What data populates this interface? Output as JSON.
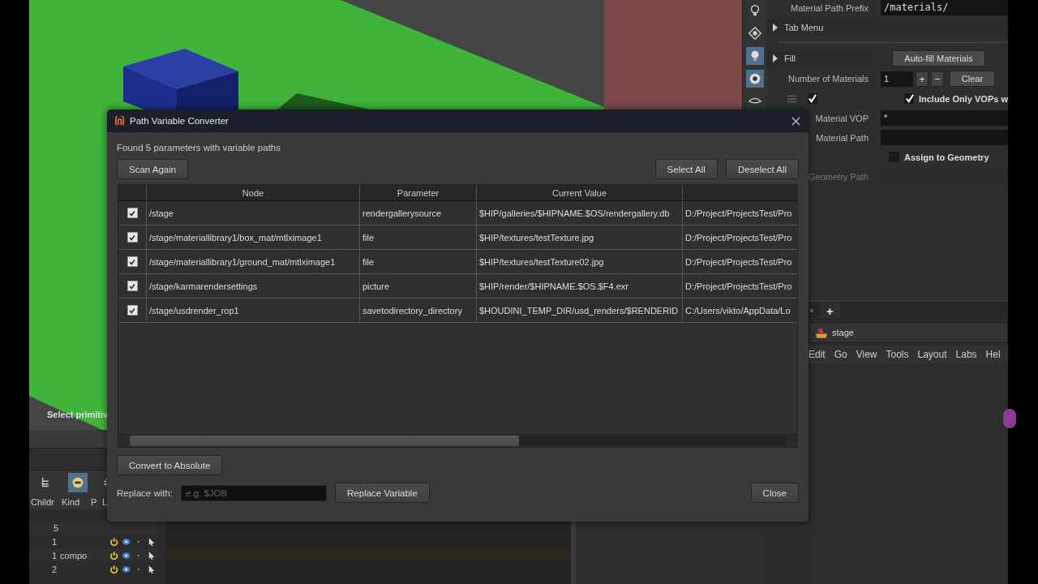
{
  "viewport": {
    "prompt": "Select primitiv"
  },
  "parameters": {
    "prefix": {
      "label": "Material Path Prefix",
      "value": "/materials/"
    },
    "sections": [
      {
        "label": "Tab Menu",
        "expanded": false
      },
      {
        "label": "Fill",
        "expanded": false
      }
    ],
    "autofill_button": "Auto-fill Materials",
    "count": {
      "label": "Number of Materials",
      "value": "1",
      "plus": "+",
      "minus": "−",
      "clear": "Clear"
    },
    "row_checked": true,
    "include_only": {
      "label": "Include Only VOPs w",
      "checked": true
    },
    "material_vop": {
      "label": "Material VOP",
      "value": "*"
    },
    "material_path": {
      "label": "Material Path"
    },
    "assign": {
      "label": "Assign to Geometry",
      "checked": false
    },
    "geometry_path": {
      "label": "Geometry Path",
      "disabled": true
    }
  },
  "network": {
    "new_tab": "+",
    "path": "stage",
    "menu": [
      "Edit",
      "Go",
      "View",
      "Tools",
      "Layout",
      "Labs",
      "Hel"
    ]
  },
  "scene_graph": {
    "columns": [
      "Childr",
      "Kind",
      "P",
      "L"
    ],
    "rows": [
      {
        "children": "5",
        "toggles": false
      },
      {
        "children": "1",
        "toggles": true
      },
      {
        "children": "1",
        "kind": "compo",
        "toggles": true
      },
      {
        "children": "2",
        "toggles": true
      }
    ]
  },
  "dialog": {
    "title": "Path Variable Converter",
    "message": "Found 5 parameters with variable paths",
    "scan_button": "Scan Again",
    "select_all": "Select All",
    "deselect_all": "Deselect All",
    "table": {
      "columns": [
        "Node",
        "Parameter",
        "Current Value"
      ],
      "rows": [
        {
          "checked": true,
          "node": "/stage",
          "parameter": "rendergallerysource",
          "current_value": "$HIP/galleries/$HIPNAME.$OS/rendergallery.db",
          "column_5": "D:/Project/ProjectsTest/Pro"
        },
        {
          "checked": true,
          "node": "/stage/materiallibrary1/box_mat/mtlximage1",
          "parameter": "file",
          "current_value": "$HIP/textures/testTexture.jpg",
          "column_5": "D:/Project/ProjectsTest/Pro"
        },
        {
          "checked": true,
          "node": "/stage/materiallibrary1/ground_mat/mtlximage1",
          "parameter": "file",
          "current_value": "$HIP/textures/testTexture02.jpg",
          "column_5": "D:/Project/ProjectsTest/Pro"
        },
        {
          "checked": true,
          "node": "/stage/karmarendersettings",
          "parameter": "picture",
          "current_value": "$HIP/render/$HIPNAME.$OS.$F4.exr",
          "column_5": "D:/Project/ProjectsTest/Pro"
        },
        {
          "checked": true,
          "node": "/stage/usdrender_rop1",
          "parameter": "savetodirectory_directory",
          "current_value": "$HOUDINI_TEMP_DIR/usd_renders/$RENDERID",
          "column_5": "C:/Users/vikto/AppData/Lo"
        }
      ]
    },
    "convert_button": "Convert to Absolute",
    "replace_label": "Replace with:",
    "replace_placeholder": "e.g. $JOB",
    "replace_button": "Replace Variable",
    "close_button": "Close"
  }
}
